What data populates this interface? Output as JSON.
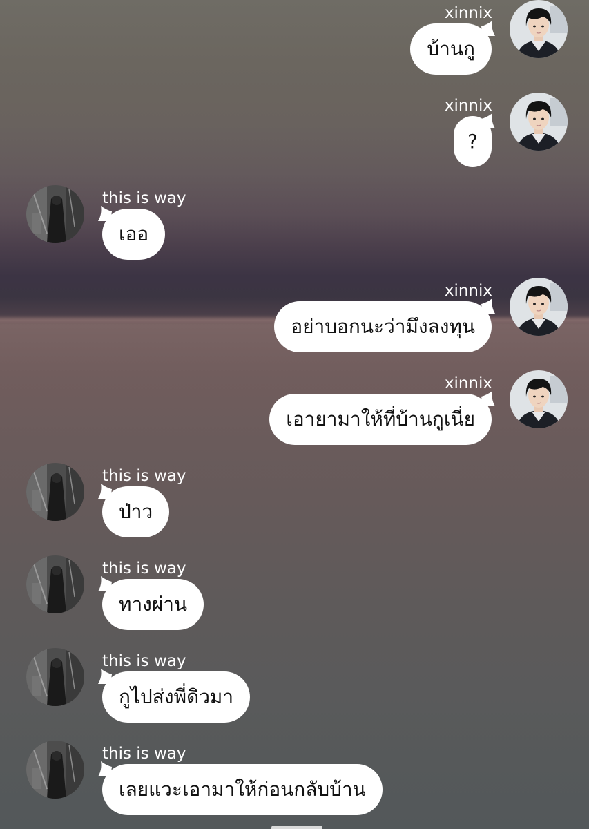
{
  "chat": {
    "messages": [
      {
        "side": "right",
        "sender": "xinnix",
        "text": "บ้านกู",
        "avatar": "boy-avatar"
      },
      {
        "side": "right",
        "sender": "xinnix",
        "text": "?",
        "avatar": "boy-avatar"
      },
      {
        "side": "left",
        "sender": "this is way",
        "text": "เออ",
        "avatar": "dark-avatar"
      },
      {
        "side": "right",
        "sender": "xinnix",
        "text": "อย่าบอกนะว่ามึงลงทุน",
        "avatar": "boy-avatar"
      },
      {
        "side": "right",
        "sender": "xinnix",
        "text": "เอายามาให้ที่บ้านกูเนี่ย",
        "avatar": "boy-avatar"
      },
      {
        "side": "left",
        "sender": "this is way",
        "text": "ป่าว",
        "avatar": "dark-avatar"
      },
      {
        "side": "left",
        "sender": "this is way",
        "text": "ทางผ่าน",
        "avatar": "dark-avatar"
      },
      {
        "side": "left",
        "sender": "this is way",
        "text": "กูไปส่งพี่ดิวมา",
        "avatar": "dark-avatar"
      },
      {
        "side": "left",
        "sender": "this is way",
        "text": "เลยแวะเอามาให้ก่อนกลับบ้าน",
        "avatar": "dark-avatar"
      }
    ]
  },
  "colors": {
    "bubble": "#ffffff",
    "bubble_text": "#111111",
    "name_text": "#ffffff"
  }
}
